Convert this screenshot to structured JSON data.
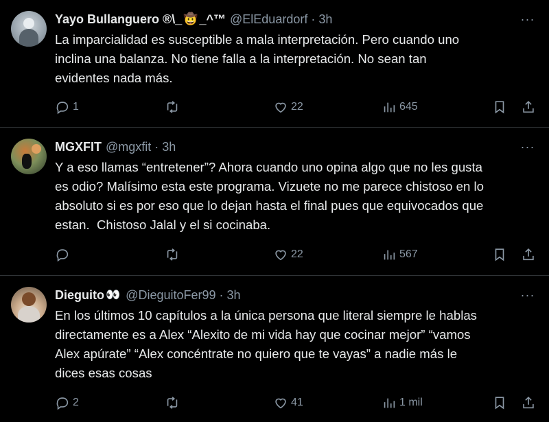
{
  "tweets": [
    {
      "name": "Yayo Bullanguero ®\\_",
      "emoji": "🤠",
      "name_suffix": "_^™",
      "handle": "@ElEduardorf",
      "separator": "·",
      "time": "3h",
      "more": "···",
      "text": "La imparcialidad es susceptible a mala interpretación. Pero cuando uno\ninclina una balanza. No tiene falla a la interpretación. No sean tan\nevidentes nada más.",
      "replies": "1",
      "retweets": "",
      "likes": "22",
      "views": "645"
    },
    {
      "name": "MGXFIT",
      "emoji": "",
      "name_suffix": "",
      "handle": "@mgxfit",
      "separator": "·",
      "time": "3h",
      "more": "···",
      "text": "Y a eso llamas “entretener”? Ahora cuando uno opina algo que no les gusta\nes odio? Malísimo esta este programa. Vizuete no me parece chistoso en lo\nabsoluto si es por eso que lo dejan hasta el final pues que equivocados que\nestan.  Chistoso Jalal y el si cocinaba.",
      "replies": "",
      "retweets": "",
      "likes": "22",
      "views": "567"
    },
    {
      "name": "Dieguito",
      "emoji": "👀",
      "name_suffix": "",
      "handle": "@DieguitoFer99",
      "separator": "·",
      "time": "3h",
      "more": "···",
      "text": "En los últimos 10 capítulos a la única persona que literal siempre le hablas\ndirectamente es a Alex “Alexito de mi vida hay que cocinar mejor” “vamos\nAlex apúrate” “Alex concéntrate no quiero que te vayas” a nadie más le\ndices esas cosas",
      "replies": "2",
      "retweets": "",
      "likes": "41",
      "views": "1 mil"
    }
  ],
  "icons": {
    "reply": "reply-icon",
    "retweet": "retweet-icon",
    "like": "heart-icon",
    "views": "views-chart-icon",
    "bookmark": "bookmark-icon",
    "share": "share-icon",
    "more": "more-icon"
  },
  "colors": {
    "background": "#000000",
    "text_primary": "#e7e9ea",
    "text_secondary": "#8b98a5",
    "divider": "#2f3336"
  }
}
